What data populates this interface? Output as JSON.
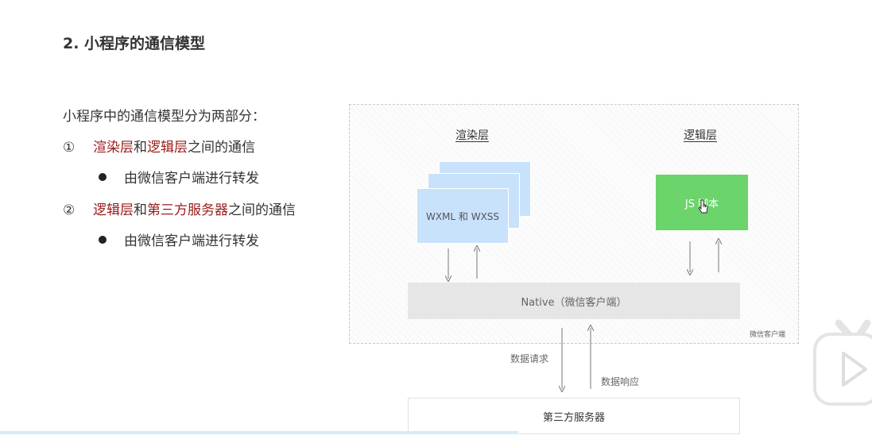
{
  "title": "2. 小程序的通信模型",
  "intro": "小程序中的通信模型分为两部分：",
  "items": [
    {
      "num": "①",
      "parts": [
        "渲染层",
        "和",
        "逻辑层",
        "之间的通信"
      ],
      "sub": "由微信客户端进行转发"
    },
    {
      "num": "②",
      "parts": [
        "逻辑层",
        "和",
        "第三方服务器",
        "之间的通信"
      ],
      "sub": "由微信客户端进行转发"
    }
  ],
  "diagram": {
    "render_layer": "渲染层",
    "logic_layer": "逻辑层",
    "render_box": "WXML 和 WXSS",
    "logic_box": "JS 脚本",
    "native": "Native（微信客户端）",
    "client_note": "微信客户端",
    "request_label": "数据请求",
    "response_label": "数据响应",
    "server": "第三方服务器"
  },
  "colors": {
    "highlight": "#9b1b1b",
    "render_card": "#c9e2fb",
    "logic_box": "#6bd46b",
    "native": "#e6e6e6"
  },
  "icons": {
    "overlay": "tv-play-icon",
    "cursor": "pointer-cursor-icon"
  }
}
